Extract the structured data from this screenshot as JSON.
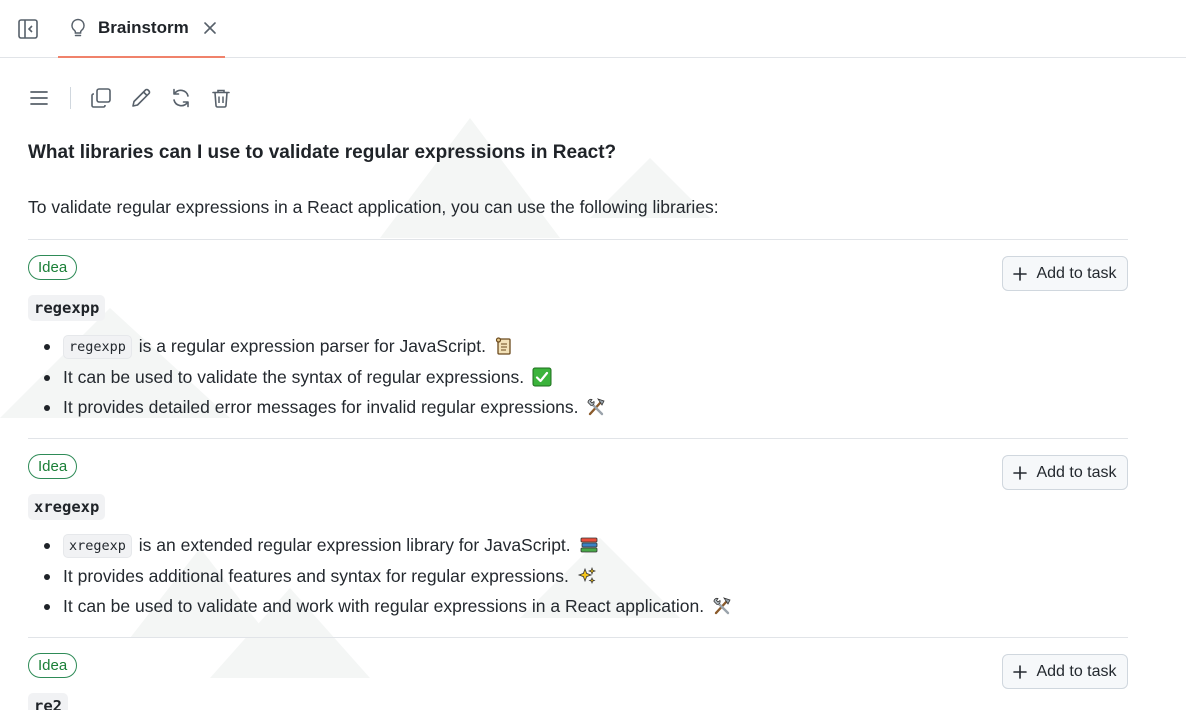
{
  "tab": {
    "title": "Brainstorm",
    "icon": "lightbulb-icon",
    "accent_color": "#f0826b"
  },
  "toolbar": {
    "icons": [
      "menu-icon",
      "copy-icon",
      "edit-icon",
      "refresh-icon",
      "trash-icon"
    ]
  },
  "conversation": {
    "question": "What libraries can I use to validate regular expressions in React?",
    "intro": "To validate regular expressions in a React application, you can use the following libraries:"
  },
  "ideas": [
    {
      "badge": "Idea",
      "name": "regexpp",
      "add_label": "Add to task",
      "bullets": [
        {
          "code": "regexpp",
          "text": " is a regular expression parser for JavaScript. ",
          "emoji": "scroll-icon"
        },
        {
          "code": "",
          "text": "It can be used to validate the syntax of regular expressions. ",
          "emoji": "check-mark-icon"
        },
        {
          "code": "",
          "text": "It provides detailed error messages for invalid regular expressions. ",
          "emoji": "tools-icon"
        }
      ]
    },
    {
      "badge": "Idea",
      "name": "xregexp",
      "add_label": "Add to task",
      "bullets": [
        {
          "code": "xregexp",
          "text": " is an extended regular expression library for JavaScript. ",
          "emoji": "books-icon"
        },
        {
          "code": "",
          "text": "It provides additional features and syntax for regular expressions. ",
          "emoji": "sparkles-icon"
        },
        {
          "code": "",
          "text": "It can be used to validate and work with regular expressions in a React application. ",
          "emoji": "tools-icon"
        }
      ]
    },
    {
      "badge": "Idea",
      "name": "re2",
      "add_label": "Add to task",
      "bullets": []
    }
  ],
  "colors": {
    "idea_badge": "#1a7f37",
    "border": "#d0d7de"
  }
}
